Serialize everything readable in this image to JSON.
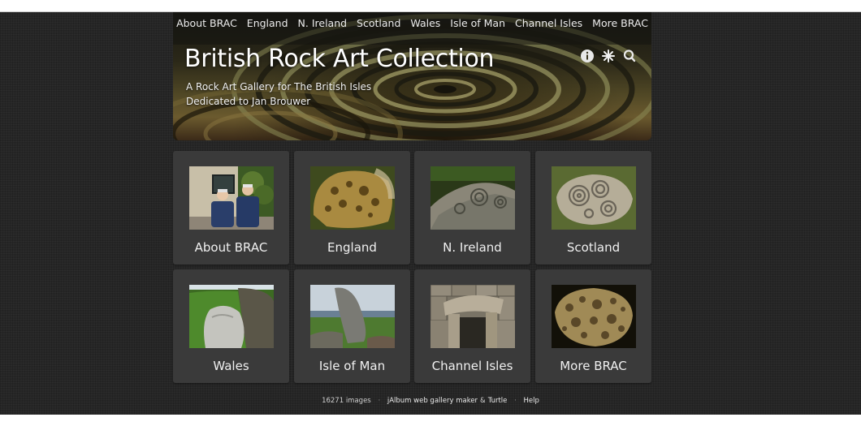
{
  "nav": {
    "items": [
      "About BRAC",
      "England",
      "N. Ireland",
      "Scotland",
      "Wales",
      "Isle of Man",
      "Channel Isles",
      "More BRAC"
    ]
  },
  "header": {
    "title": "British Rock Art Collection",
    "subtitle_1": "A Rock Art Gallery for The British Isles",
    "subtitle_2": "Dedicated to Jan Brouwer",
    "icons": [
      "info-icon",
      "slideshow-star-icon",
      "search-icon"
    ]
  },
  "tiles": [
    {
      "label": "About BRAC"
    },
    {
      "label": "England"
    },
    {
      "label": "N. Ireland"
    },
    {
      "label": "Scotland"
    },
    {
      "label": "Wales"
    },
    {
      "label": "Isle of Man"
    },
    {
      "label": "Channel Isles"
    },
    {
      "label": "More BRAC"
    }
  ],
  "footer": {
    "count": "16271 images",
    "maker": "jAlbum web gallery maker",
    "amp": "&",
    "skin": "Turtle",
    "help": "Help",
    "sep": "·"
  },
  "colors": {
    "background": "#262626",
    "tile": "#3a3a3a",
    "text": "#f0f0f0"
  }
}
